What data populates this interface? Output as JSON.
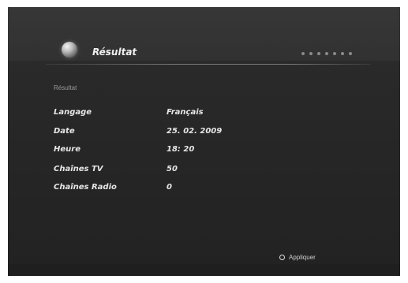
{
  "header": {
    "title": "Résultat",
    "globe_icon": "globe-icon",
    "step_dots": 7
  },
  "section": {
    "label": "Résultat"
  },
  "rows": [
    {
      "label": "Langage",
      "value": "Français"
    },
    {
      "label": "Date",
      "value": "25. 02. 2009"
    },
    {
      "label": "Heure",
      "value": "18: 20"
    },
    {
      "label": "Chaînes TV",
      "value": "50"
    },
    {
      "label": "Chaînes Radio",
      "value": "0"
    }
  ],
  "footer": {
    "apply_label": "Appliquer",
    "apply_icon": "circle-button-icon"
  },
  "colors": {
    "background": "#2a2a2a",
    "text": "#e6e6e6"
  }
}
